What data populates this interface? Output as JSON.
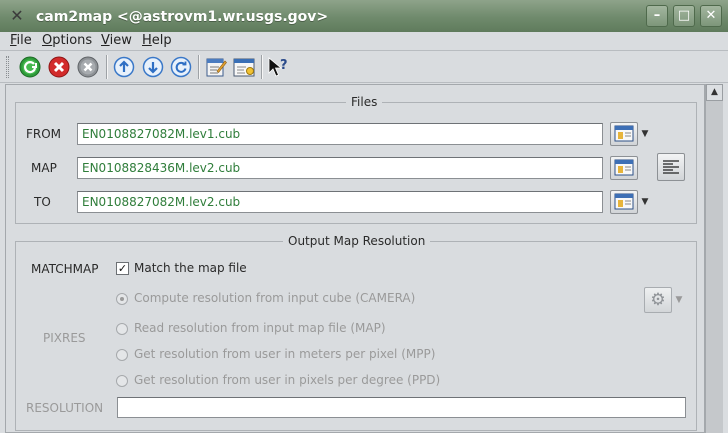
{
  "window": {
    "title": "cam2map <@astrovm1.wr.usgs.gov>",
    "buttons": {
      "minimize": "–",
      "maximize": "□",
      "close": "✕"
    }
  },
  "menu": [
    {
      "label": "File",
      "accel": "F",
      "rest": "ile"
    },
    {
      "label": "Options",
      "accel": "O",
      "rest": "ptions"
    },
    {
      "label": "View",
      "accel": "V",
      "rest": "iew"
    },
    {
      "label": "Help",
      "accel": "H",
      "rest": "elp"
    }
  ],
  "toolbar": {
    "icons": [
      "run-icon",
      "stop-icon",
      "reset-icon",
      "previous-history-icon",
      "next-history-icon",
      "refresh-icon",
      "edit-parameters-icon",
      "preferences-icon",
      "whats-this-icon"
    ]
  },
  "files": {
    "title": "Files",
    "from": {
      "label": "FROM",
      "value": "EN0108827082M.lev1.cub"
    },
    "map": {
      "label": "MAP",
      "value": "EN0108828436M.lev2.cub"
    },
    "to": {
      "label": "TO",
      "value": "EN0108827082M.lev2.cub"
    }
  },
  "resolution": {
    "title": "Output Map Resolution",
    "matchmap": {
      "label": "MATCHMAP",
      "checkbox_label": "Match the map file",
      "checked": true
    },
    "pixres": {
      "label": "PIXRES",
      "options": [
        {
          "label": "Compute resolution from input cube (CAMERA)",
          "selected": true
        },
        {
          "label": "Read resolution from input map file (MAP)",
          "selected": false
        },
        {
          "label": "Get resolution from user in meters per pixel (MPP)",
          "selected": false
        },
        {
          "label": "Get resolution from user in pixels per degree (PPD)",
          "selected": false
        }
      ]
    },
    "resolution_field": {
      "label": "RESOLUTION",
      "value": ""
    }
  },
  "colors": {
    "titlebar": "#6f8a6c",
    "input_text": "#2f7d3a",
    "dim_text": "#9a9a9a"
  }
}
